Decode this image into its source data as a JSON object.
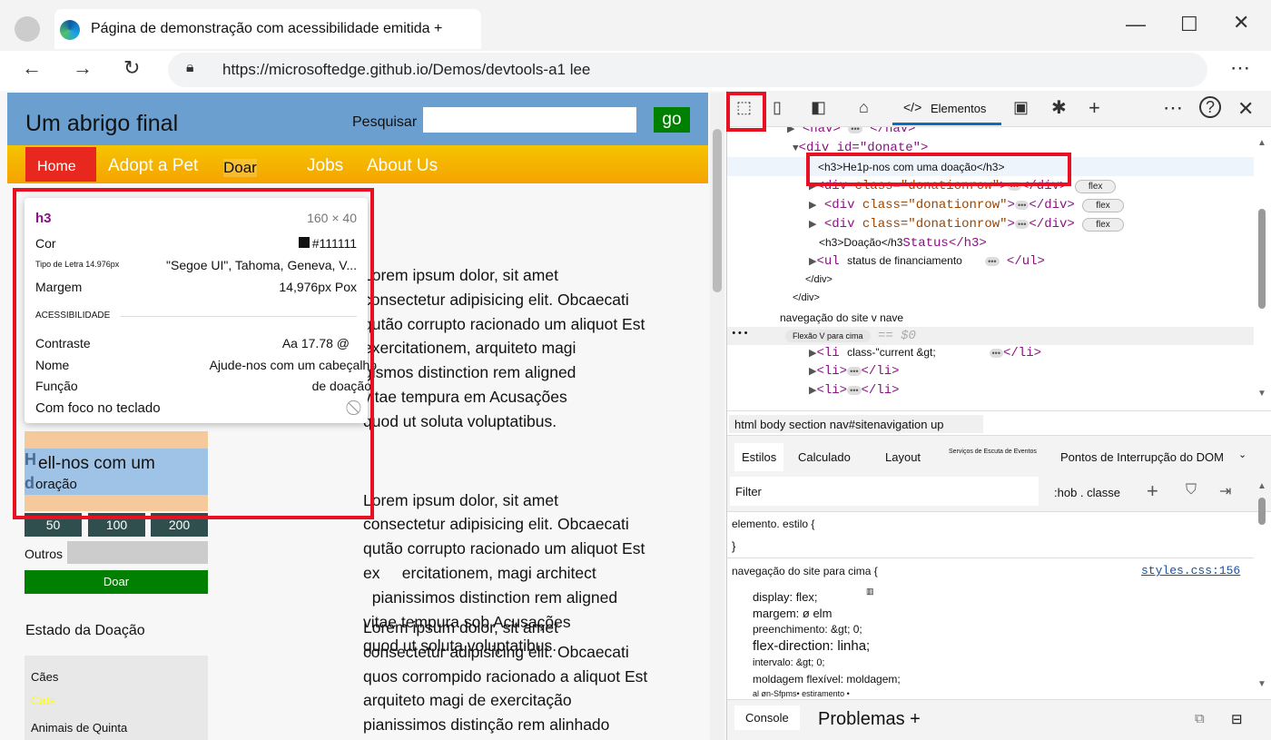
{
  "browser": {
    "tab_title": "Página de demonstração com acessibilidade emitida +",
    "url": "https://microsoftedge.github.io/Demos/devtools-a1 lee"
  },
  "site": {
    "title": "Um abrigo final",
    "search_label": "Pesquisar",
    "go": "go",
    "nav": [
      "Home",
      "Adopt a Pet",
      "Doar",
      "Jobs",
      "About Us"
    ],
    "donate_heading_a": "ell-nos com um",
    "donate_heading_b": "oração",
    "donate_initial_a": "H",
    "donate_initial_b": "d",
    "amounts": [
      "50",
      "100",
      "200"
    ],
    "other_label": "Outros",
    "donate_button": "Doar",
    "status_heading": "Estado da Doação",
    "status_items": [
      "Cães",
      "Cats",
      "Animais de Quinta"
    ],
    "paragraphs": [
      [
        "Lorem ipsum dolor, sit amet",
        "consectetur adipisicing elit. Obcaecati",
        "qutão corrupto racionado um aliquot Est",
        "exercitationem, arquiteto magi",
        "gismos distinction rem aligned",
        "vitae tempura em Acusações",
        "quod ut soluta voluptatibus."
      ],
      [
        "Lorem ipsum dolor, sit amet",
        "consectetur adipisicing elit. Obcaecati",
        "qutão corrupto racionado um aliquot Est",
        "ex     ercitationem, magi architect",
        "  pianissimos distinction rem aligned",
        "vitae tempura sob Acusações",
        "quod ut soluta voluptatibus."
      ],
      [
        "Lorem ipsum dolor, sit amet",
        "consectetur adipisicing elit. Obcaecati",
        "quos corrompido racionado a aliquot Est",
        "arquiteto magi de exercitação",
        "pianissimos distinção rem alinhado"
      ]
    ]
  },
  "tooltip": {
    "tag": "h3",
    "size": "160 × 40",
    "color_label": "Cor",
    "color_value": "#111111",
    "font_label": "Tipo de Letra 14.976px",
    "font_value": "\"Segoe UI\", Tahoma, Geneva, V...",
    "margin_label": "Margem",
    "margin_value": "14,976px Pox",
    "section": "ACESSIBILIDADE",
    "contrast_label": "Contraste",
    "contrast_value": "Aa 17.78 @",
    "name_label": "Nome",
    "name_value": "Ajude-nos com um cabeçalho",
    "role_label": "Função",
    "role_value": "de doação",
    "focus_label": "Com foco no teclado"
  },
  "devtools": {
    "elements_tab": "Elementos",
    "dom": {
      "nav": "<nav>",
      "nav_close": "</nav>",
      "donate": "<div id=\"donate\">",
      "h3_selected": "<h3>He1p-nos com uma doação</h3>",
      "donationrow": "class=\"donationrow\"",
      "flex": "flex",
      "h3_status_a": "<h3>Doação</h3",
      "h3_status_b": "Status</h3>",
      "ul": "<ul",
      "ul_text": "status de financiamento",
      "ul_close": "</ul>",
      "div_close": "</div>",
      "sitenav": "navegação do site v nave",
      "flex_up": "Flexão V para cima",
      "eq": "== $0",
      "li_current": "class-\"current &gt;",
      "li": "<li>",
      "li_close": "</li>"
    },
    "breadcrumb": "html body section nav#sitenavigation up",
    "panel_tabs": [
      "Estilos",
      "Calculado",
      "Layout",
      "Serviços de Escuta de Eventos",
      "Pontos de Interrupção do DOM"
    ],
    "filter_placeholder": "Filter",
    "hov_cls": ":hob . classe",
    "element_style": "elemento. estilo {",
    "close_brace": "}",
    "rule_selector": "navegação do site para cima {",
    "rule_source": "styles.css:156",
    "props": [
      "display: flex;",
      "margem: ø elm",
      "preenchimento: &gt; 0;",
      "flex-direction: linha;",
      "intervalo: &gt; 0;",
      "moldagem flexível: moldagem;",
      "al øn-Sfpms• estiramento •"
    ],
    "drawer": [
      "Console",
      "Problemas +"
    ]
  }
}
